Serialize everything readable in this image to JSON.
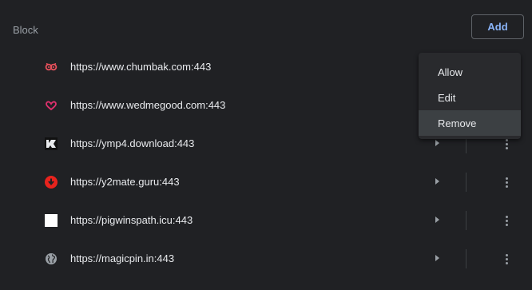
{
  "section": {
    "label": "Block"
  },
  "toolbar": {
    "add_label": "Add"
  },
  "sites": [
    {
      "url": "https://www.chumbak.com:443",
      "icon": "chumbak-owl-icon",
      "color": "#e8505b"
    },
    {
      "url": "https://www.wedmegood.com:443",
      "icon": "wedmegood-heart-icon",
      "color": "#e0316e"
    },
    {
      "url": "https://ymp4.download:443",
      "icon": "ymp4-logo-icon",
      "color": "#000000"
    },
    {
      "url": "https://y2mate.guru:443",
      "icon": "y2mate-download-icon",
      "color": "#e8231d"
    },
    {
      "url": "https://pigwinspath.icu:443",
      "icon": "blank-page-icon",
      "color": "#ffffff"
    },
    {
      "url": "https://magicpin.in:443",
      "icon": "globe-icon",
      "color": "#9aa0a6"
    }
  ],
  "context_menu": {
    "items": [
      {
        "label": "Allow"
      },
      {
        "label": "Edit"
      },
      {
        "label": "Remove"
      }
    ],
    "highlighted": "Remove"
  },
  "colors": {
    "background": "#202124",
    "menu_background": "#292a2d",
    "accent": "#8ab4f8",
    "text": "#e8eaed",
    "secondary_text": "#9aa0a6"
  }
}
